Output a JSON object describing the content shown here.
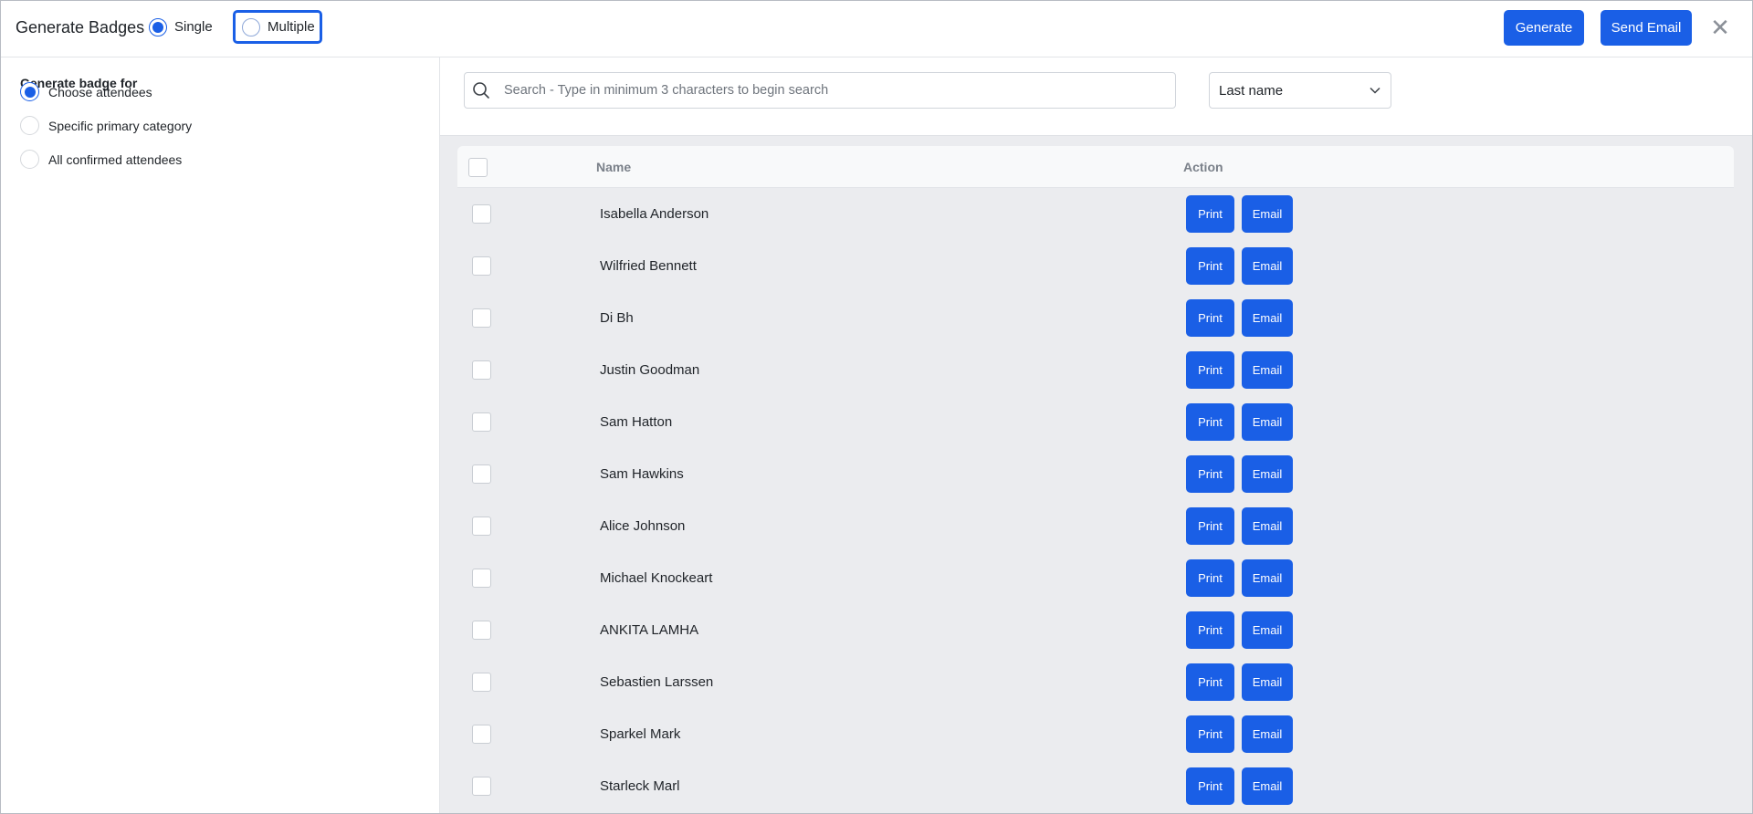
{
  "header": {
    "title": "Generate Badges",
    "mode_single": "Single",
    "mode_multiple": "Multiple",
    "generate_label": "Generate",
    "send_email_label": "Send Email",
    "close_glyph": "✕"
  },
  "sidebar": {
    "label": "Generate badge for",
    "options": [
      {
        "label": "Choose attendees",
        "selected": true
      },
      {
        "label": "Specific primary category",
        "selected": false
      },
      {
        "label": "All confirmed attendees",
        "selected": false
      }
    ]
  },
  "search": {
    "placeholder": "Search - Type in minimum 3 characters to begin search",
    "value": ""
  },
  "sort": {
    "selected": "Last name"
  },
  "table": {
    "columns": {
      "name": "Name",
      "action": "Action"
    },
    "print_label": "Print",
    "email_label": "Email",
    "rows": [
      "Isabella Anderson",
      "Wilfried Bennett",
      "Di Bh",
      "Justin Goodman",
      "Sam Hatton",
      "Sam Hawkins",
      "Alice Johnson",
      "Michael Knockeart",
      "ANKITA LAMHA",
      "Sebastien Larssen",
      "Sparkel Mark",
      "Starleck Marl"
    ]
  },
  "colors": {
    "accent": "#1a5fe6",
    "table_bg": "#ebecef"
  },
  "icons": {
    "search": "search-icon",
    "chevron": "chevron-down-icon",
    "close": "close-icon"
  }
}
